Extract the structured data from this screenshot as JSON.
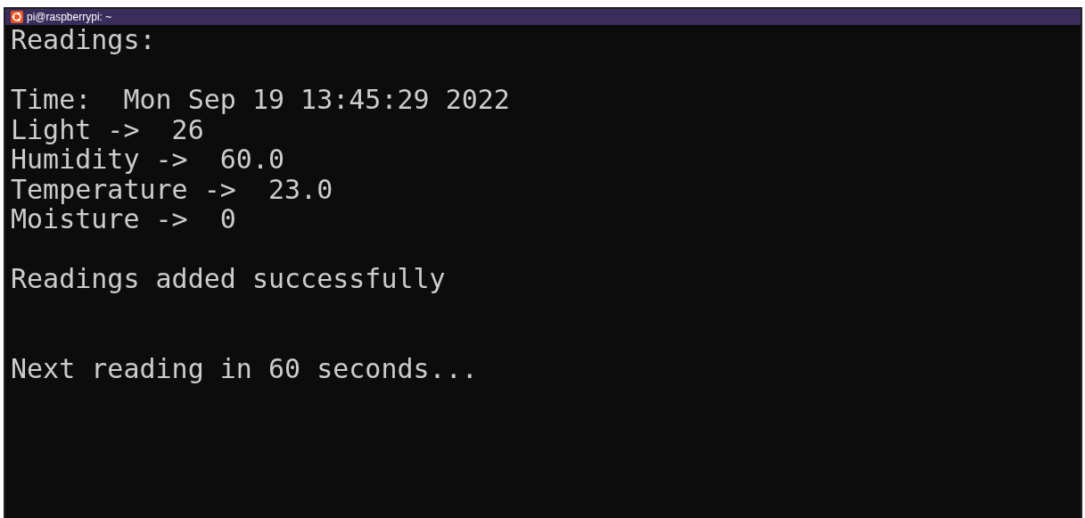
{
  "window": {
    "title": "pi@raspberrypi: ~"
  },
  "terminal": {
    "groups": [
      {
        "kind": "heading",
        "lines": [
          "Readings:"
        ]
      },
      {
        "kind": "block",
        "lines": [
          "Time:  Mon Sep 19 13:45:29 2022",
          "Light ->  26",
          "Humidity ->  60.0",
          "Temperature ->  23.0",
          "Moisture ->  0"
        ]
      },
      {
        "kind": "block",
        "lines": [
          "Readings added successfully"
        ]
      },
      {
        "kind": "footer",
        "lines": [
          "Next reading in 60 seconds..."
        ]
      }
    ]
  }
}
